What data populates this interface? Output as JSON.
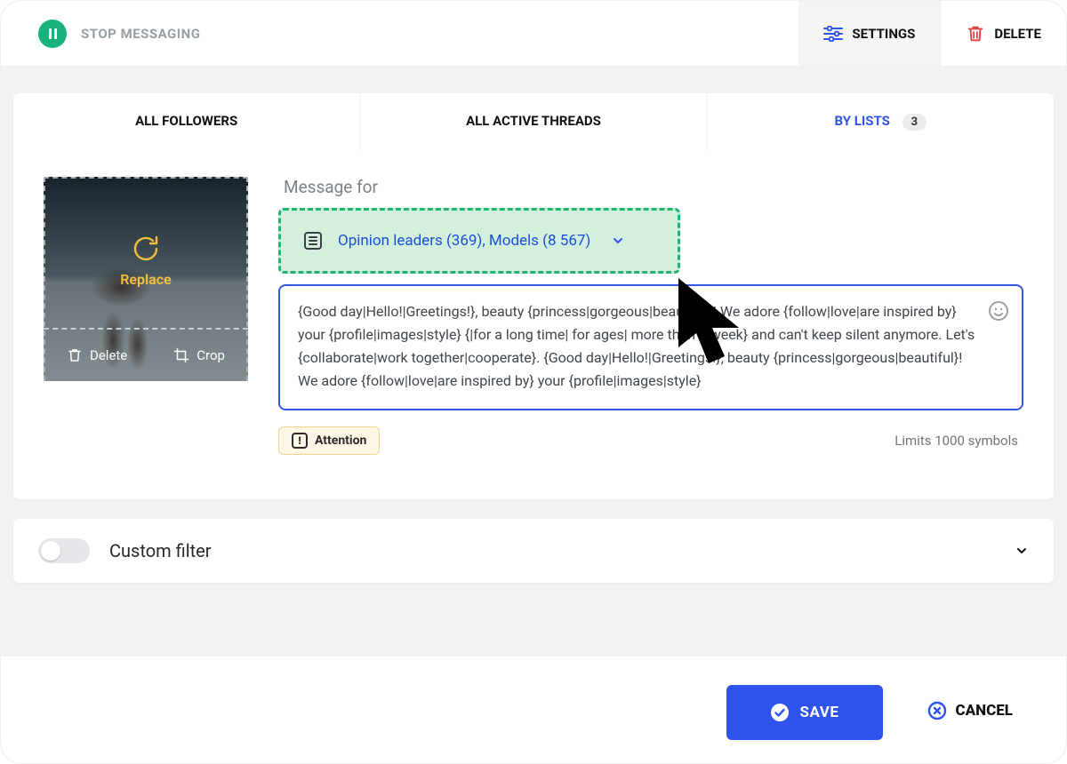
{
  "topbar": {
    "stop_label": "STOP MESSAGING",
    "settings_label": "SETTINGS",
    "delete_label": "DELETE"
  },
  "tabs": {
    "followers": "ALL FOLLOWERS",
    "threads": "ALL ACTIVE THREADS",
    "lists": "BY LISTS",
    "lists_count": "3"
  },
  "thumb": {
    "replace": "Replace",
    "delete": "Delete",
    "crop": "Crop"
  },
  "editor": {
    "label": "Message for",
    "selected_lists": "Opinion leaders (369), Models (8 567)",
    "message": "{Good day|Hello!|Greetings!}, beauty {princess|gorgeous|beautiful}! We adore {follow|love|are inspired by} your {profile|images|style} {|for a long time| for ages| more than a week} and can't keep silent anymore. Let's {collaborate|work together|cooperate}. {Good day|Hello!|Greetings!}, beauty {princess|gorgeous|beautiful}! We adore {follow|love|are inspired by} your {profile|images|style}",
    "attention": "Attention",
    "limits": "Limits 1000 symbols"
  },
  "filter": {
    "label": "Custom filter"
  },
  "footer": {
    "save": "SAVE",
    "cancel": "CANCEL"
  },
  "colors": {
    "accent": "#2f54eb",
    "success": "#20b574",
    "danger": "#e04141"
  }
}
